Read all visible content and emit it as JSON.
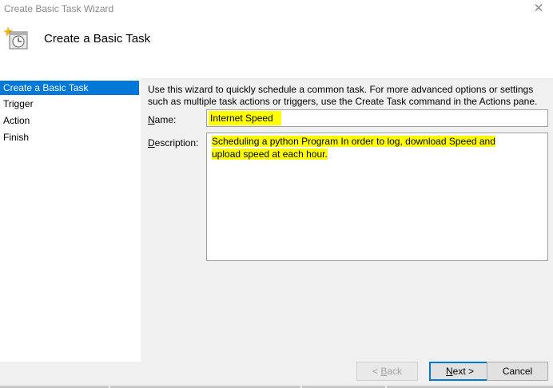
{
  "window": {
    "title": "Create Basic Task Wizard",
    "close_glyph": "✕"
  },
  "header": {
    "title": "Create a Basic Task",
    "icon": "task-scheduler-clock-icon"
  },
  "steps": [
    {
      "label": "Create a Basic Task",
      "active": true
    },
    {
      "label": "Trigger",
      "active": false
    },
    {
      "label": "Action",
      "active": false
    },
    {
      "label": "Finish",
      "active": false
    }
  ],
  "main": {
    "intro": "Use this wizard to quickly schedule a common task.  For more advanced options or settings such as multiple task actions or triggers, use the Create Task command in the Actions pane.",
    "name_label": {
      "key": "N",
      "rest": "ame:"
    },
    "name_value": "Internet Speed",
    "description_label": {
      "key": "D",
      "rest": "escription:"
    },
    "description_value": "Scheduling a python Program In order to log, download Speed and upload speed at each hour."
  },
  "footer": {
    "back_label": {
      "pre": "< ",
      "key": "B",
      "rest": "ack"
    },
    "next_label": {
      "key": "N",
      "rest": "ext >"
    },
    "cancel_label": "Cancel"
  },
  "colors": {
    "highlight": "#ffff00",
    "accent": "#0078d7"
  }
}
